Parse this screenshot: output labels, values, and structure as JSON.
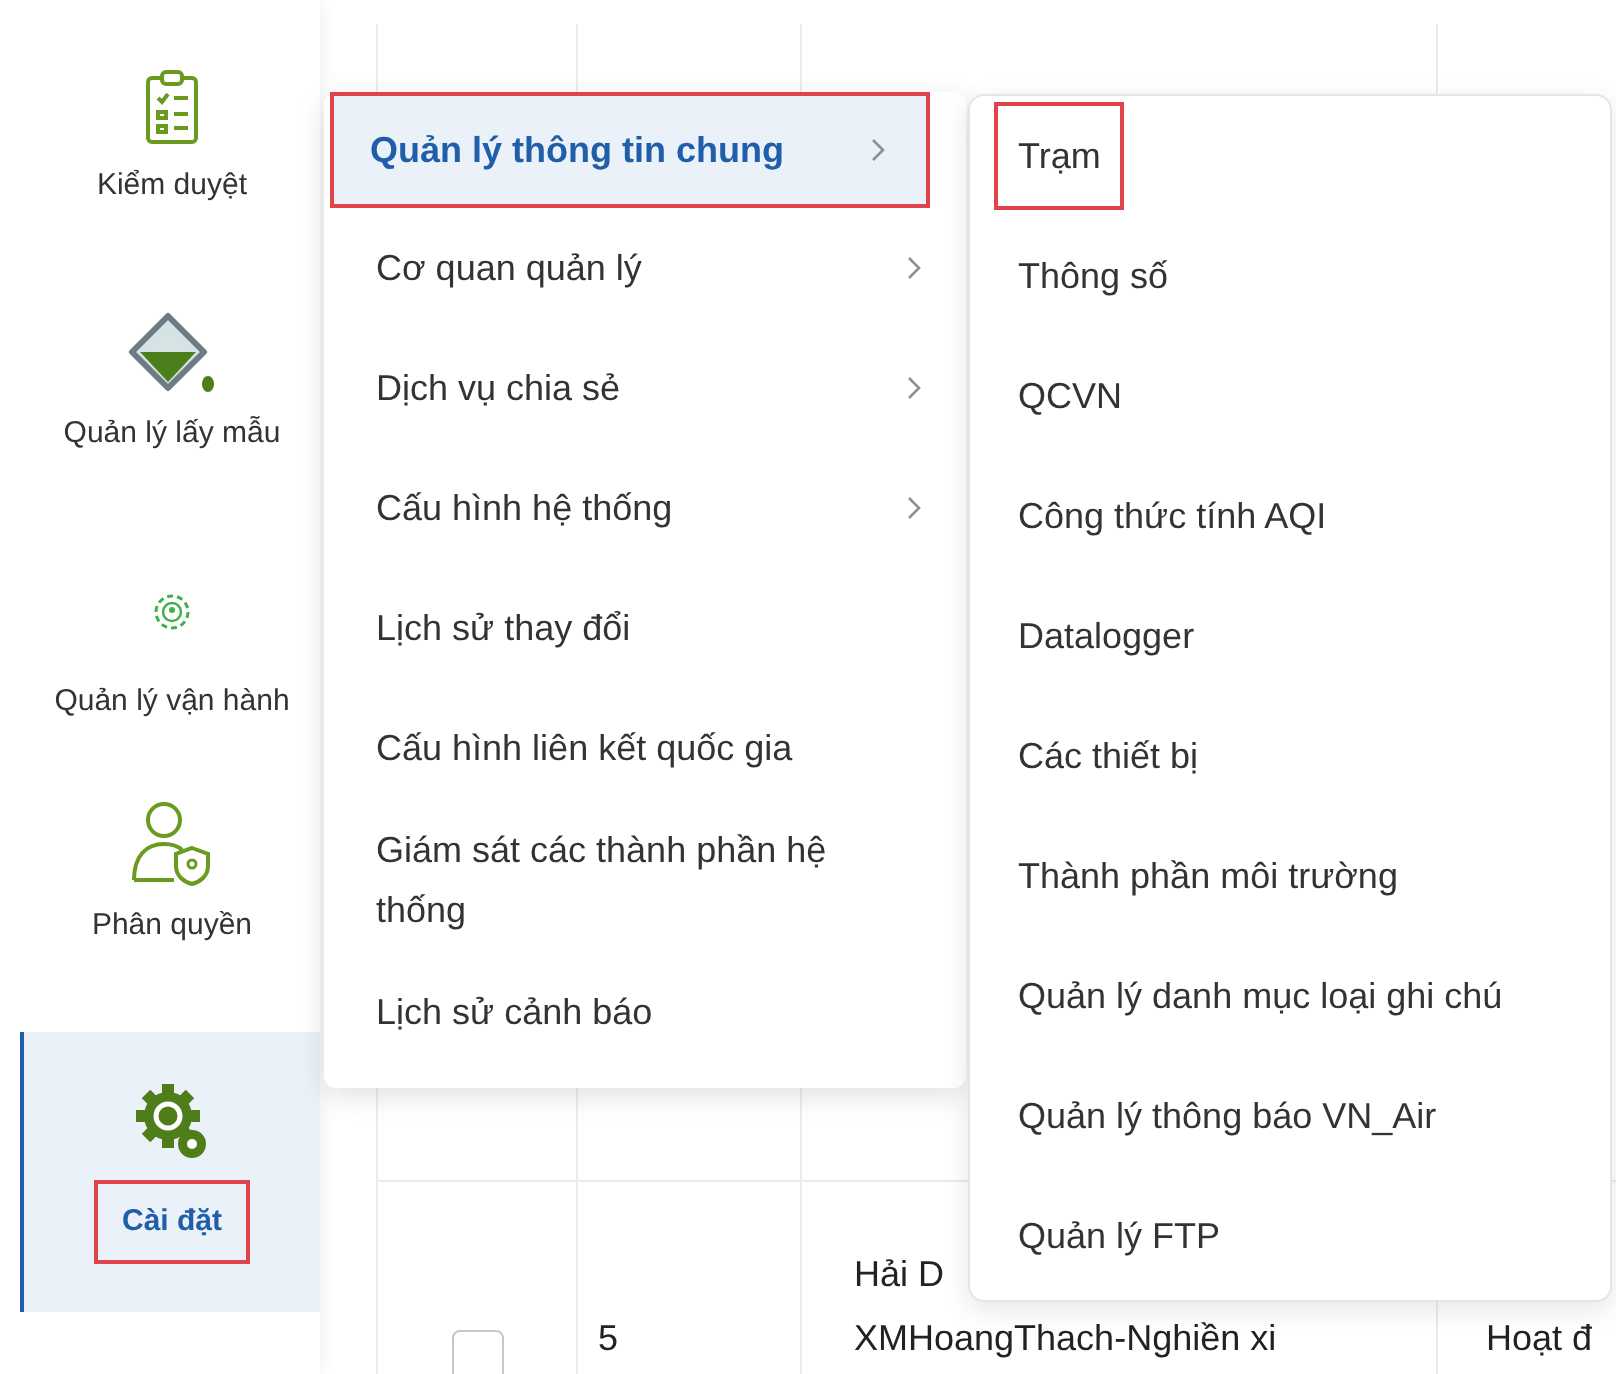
{
  "sidebar": {
    "items": [
      {
        "label": "Kiểm duyệt",
        "selected": false,
        "highlighted": false
      },
      {
        "label": "Quản lý lấy mẫu",
        "selected": false,
        "highlighted": false
      },
      {
        "label": "Quản lý vận hành",
        "selected": false,
        "highlighted": false
      },
      {
        "label": "Phân quyền",
        "selected": false,
        "highlighted": false
      },
      {
        "label": "Cài đặt",
        "selected": true,
        "highlighted": true
      }
    ]
  },
  "table": {
    "rows": [
      {
        "cells": [
          "",
          "",
          ""
        ]
      },
      {
        "checked": false,
        "cells": [
          "5",
          "Hải D\nXMHoangThach-Nghiền xi",
          "Hoạt đ"
        ]
      }
    ]
  },
  "menu": {
    "items": [
      {
        "label": "Quản lý thông tin chung",
        "submenu": true,
        "selected": true,
        "highlighted": true
      },
      {
        "label": "Cơ quan quản lý",
        "submenu": true,
        "selected": false,
        "highlighted": false
      },
      {
        "label": "Dịch vụ chia sẻ",
        "submenu": true,
        "selected": false,
        "highlighted": false
      },
      {
        "label": "Cấu hình hệ thống",
        "submenu": true,
        "selected": false,
        "highlighted": false
      },
      {
        "label": "Lịch sử thay đổi",
        "submenu": false,
        "selected": false,
        "highlighted": false
      },
      {
        "label": "Cấu hình liên kết quốc gia",
        "submenu": false,
        "selected": false,
        "highlighted": false
      },
      {
        "label": "Giám sát các thành phần hệ thống",
        "submenu": false,
        "selected": false,
        "highlighted": false
      },
      {
        "label": "Lịch sử cảnh báo",
        "submenu": false,
        "selected": false,
        "highlighted": false
      }
    ]
  },
  "submenu": {
    "items": [
      {
        "label": "Trạm",
        "highlighted": true
      },
      {
        "label": "Thông số",
        "highlighted": false
      },
      {
        "label": "QCVN",
        "highlighted": false
      },
      {
        "label": "Công thức tính AQI",
        "highlighted": false
      },
      {
        "label": "Datalogger",
        "highlighted": false
      },
      {
        "label": "Các thiết bị",
        "highlighted": false
      },
      {
        "label": "Thành phần môi trường",
        "highlighted": false
      },
      {
        "label": "Quản lý danh mục loại ghi chú",
        "highlighted": false
      },
      {
        "label": "Quản lý thông báo VN_Air",
        "highlighted": false
      },
      {
        "label": "Quản lý FTP",
        "highlighted": false
      }
    ]
  }
}
